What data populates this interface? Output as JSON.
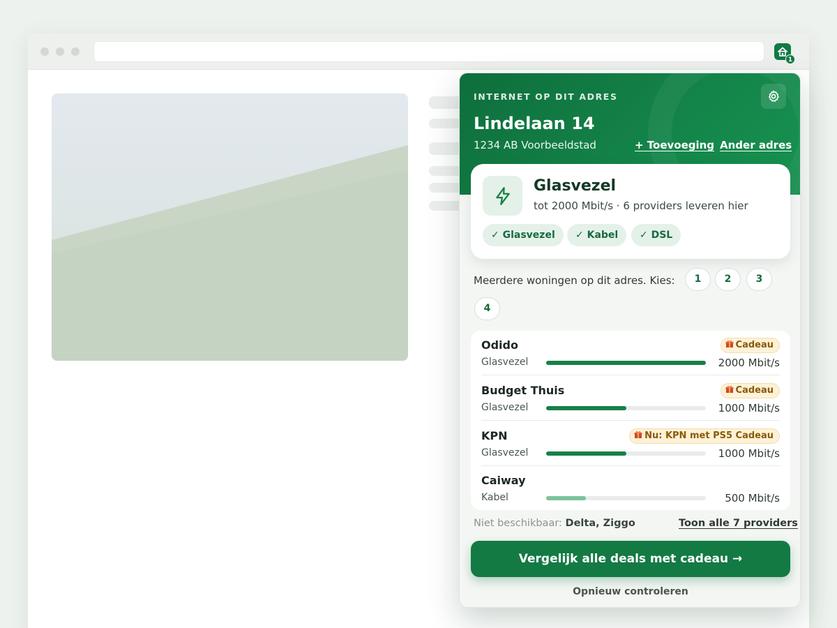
{
  "extension": {
    "badge_count": "1",
    "accent": "#117a45"
  },
  "popup": {
    "eyebrow": "INTERNET OP DIT ADRES",
    "address_line1": "Lindelaan 14",
    "address_line2": "1234 AB Voorbeeldstad",
    "add_suffix_link": "+ Toevoeging",
    "other_address_link": "Ander adres",
    "best": {
      "technology": "Glasvezel",
      "description": "tot 2000 Mbit/s · 6 providers leveren hier",
      "icon": "lightning-icon",
      "chips": [
        "✓ Glasvezel",
        "✓ Kabel",
        "✓ DSL"
      ]
    },
    "units": {
      "label": "Meerdere woningen op dit adres. Kies:",
      "options": [
        "1",
        "2",
        "3",
        "4"
      ]
    },
    "providers": [
      {
        "name": "Odido",
        "technology": "Glasvezel",
        "speed": "2000 Mbit/s",
        "speed_fraction": 1.0,
        "promo": "Cadeau"
      },
      {
        "name": "Budget Thuis",
        "technology": "Glasvezel",
        "speed": "1000 Mbit/s",
        "speed_fraction": 0.5,
        "promo": "Cadeau"
      },
      {
        "name": "KPN",
        "technology": "Glasvezel",
        "speed": "1000 Mbit/s",
        "speed_fraction": 0.5,
        "promo": "Nu: KPN met PS5 Cadeau"
      },
      {
        "name": "Caiway",
        "technology": "Kabel",
        "speed": "500 Mbit/s",
        "speed_fraction": 0.25,
        "promo": null
      }
    ],
    "unavailable_label": "Niet beschikbaar:",
    "unavailable_list": "Delta, Ziggo",
    "show_all_link": "Toon alle 7 providers",
    "cta": "Vergelijk alle deals met cadeau →",
    "retry": "Opnieuw controleren",
    "colors": {
      "brand": "#137a43",
      "promo_bg": "#fdf1d7",
      "promo_text": "#8a5a0a"
    }
  }
}
